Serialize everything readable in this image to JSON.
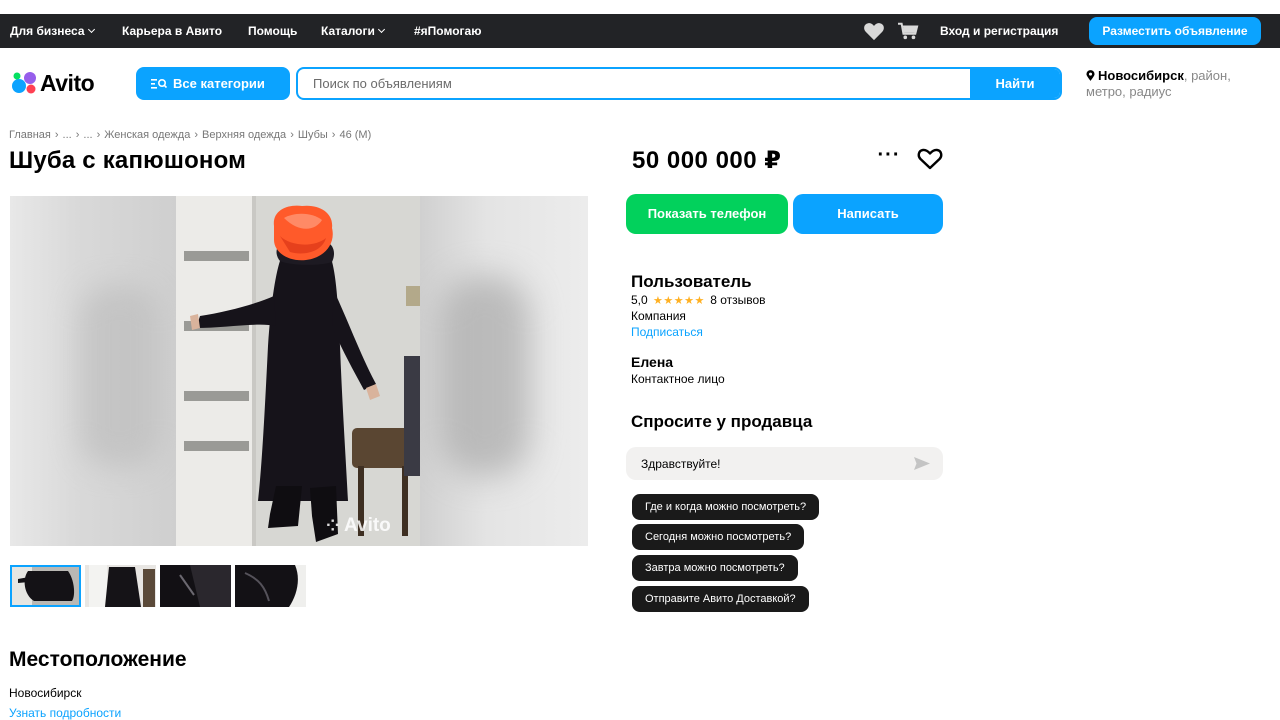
{
  "topbar": {
    "business": "Для бизнеса",
    "career": "Карьера в Авито",
    "help": "Помощь",
    "catalogs": "Каталоги",
    "hashtag": "#яПомогаю",
    "login": "Вход и регистрация",
    "post_ad": "Разместить объявление",
    "icons": [
      "heart-icon",
      "cart-icon"
    ]
  },
  "header": {
    "logo": "Avito",
    "categories_button": "Все категории",
    "search_placeholder": "Поиск по объявлениям",
    "search_button": "Найти",
    "location_city": "Новосибирск",
    "location_rest": ", район, метро, радиус"
  },
  "breadcrumb": [
    "Главная",
    "...",
    "...",
    "Женская одежда",
    "Верхняя одежда",
    "Шубы",
    "46 (M)"
  ],
  "listing": {
    "title": "Шуба с капюшоном",
    "price": "50 000 000 ₽",
    "more": "···",
    "photo_watermark": "Avito",
    "thumbnail_count": 4
  },
  "actions": {
    "show_phone": "Показать телефон",
    "write": "Написать"
  },
  "seller": {
    "name": "Пользователь",
    "rating": "5,0",
    "stars": "★★★★★",
    "reviews": "8 отзывов",
    "type": "Компания",
    "subscribe": "Подписаться",
    "contact_name": "Елена",
    "contact_role": "Контактное лицо"
  },
  "ask": {
    "title": "Спросите у продавца",
    "message_value": "Здравствуйте!",
    "quick_questions": [
      "Где и когда можно посмотреть?",
      "Сегодня можно посмотреть?",
      "Завтра можно посмотреть?",
      "Отправите Авито Доставкой?"
    ]
  },
  "location": {
    "title": "Местоположение",
    "city": "Новосибирск",
    "details_link": "Узнать подробности"
  },
  "colors": {
    "accent": "#0ba3ff",
    "green": "#02d15c",
    "topbar": "#222326",
    "star": "#ffb021"
  }
}
